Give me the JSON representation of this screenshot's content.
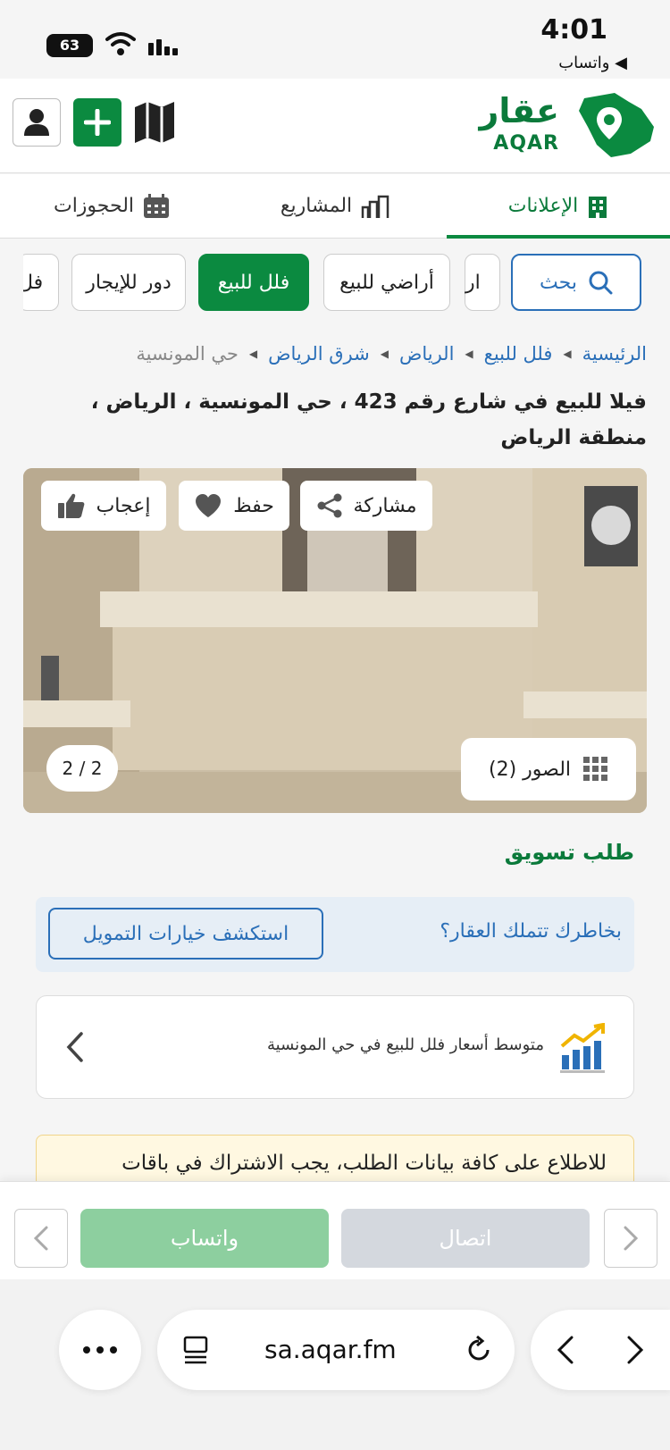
{
  "status_bar": {
    "time": "4:01",
    "back_app": "◀ واتساب",
    "battery": "63"
  },
  "header": {
    "logo_ar": "عقار",
    "logo_en": "AQAR"
  },
  "tabs": [
    {
      "label": "الإعلانات",
      "active": true
    },
    {
      "label": "المشاريع",
      "active": false
    },
    {
      "label": "الحجوزات",
      "active": false
    }
  ],
  "chips": {
    "search": "بحث",
    "partial_right": "ار",
    "lands": "أراضي للبيع",
    "villas": "فلل للبيع",
    "floors": "دور للإيجار",
    "partial_left": "فل"
  },
  "breadcrumb": [
    {
      "label": "الرئيسية",
      "current": false
    },
    {
      "label": "فلل للبيع",
      "current": false
    },
    {
      "label": "الرياض",
      "current": false
    },
    {
      "label": "شرق الرياض",
      "current": false
    },
    {
      "label": "حي المونسية",
      "current": true
    }
  ],
  "listing": {
    "title": "فيلا للبيع في شارع رقم 423 ، حي المونسية ، الرياض ، منطقة الرياض"
  },
  "photo": {
    "share": "مشاركة",
    "save": "حفظ",
    "like": "إعجاب",
    "photos_label": "الصور (2)",
    "counter": "2 / 2"
  },
  "marketing_request": "طلب تسويق",
  "finance": {
    "question": "بخاطرك تتملك العقار؟",
    "button": "استكشف خيارات التمويل"
  },
  "avg_prices": {
    "text": "متوسط أسعار فلل للبيع في حي المونسية"
  },
  "notice": {
    "text": "للاطلاع على كافة بيانات الطلب، يجب الاشتراك في باقات"
  },
  "actions": {
    "call": "اتصال",
    "whatsapp": "واتساب"
  },
  "browser": {
    "url": "sa.aqar.fm"
  },
  "colors": {
    "brand_green": "#0b8a40",
    "link_blue": "#2a6fb8"
  }
}
